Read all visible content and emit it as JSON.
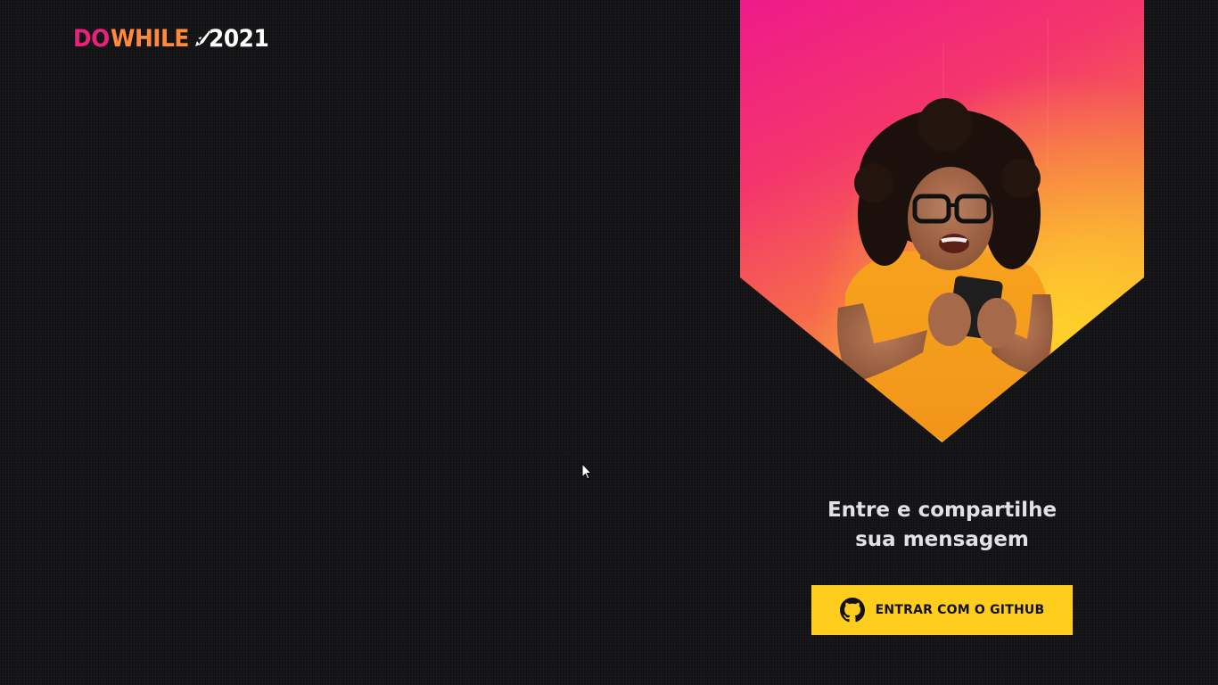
{
  "logo": {
    "do": "DO",
    "while": "WHILE",
    "year": "2021",
    "mark_icon": "rocket-icon"
  },
  "banner": {
    "image": "smiling-person-with-phone-photo",
    "gradient_colors": [
      "#ee1a8a",
      "#f66a4c",
      "#fbcd2a"
    ]
  },
  "login": {
    "headline_line1": "Entre e compartilhe",
    "headline_line2": "sua mensagem",
    "button_label": "ENTRAR COM O GITHUB",
    "button_icon": "github-icon",
    "button_color": "#ffcd1e"
  },
  "colors": {
    "background": "#121214",
    "text": "#e1e1e6"
  }
}
